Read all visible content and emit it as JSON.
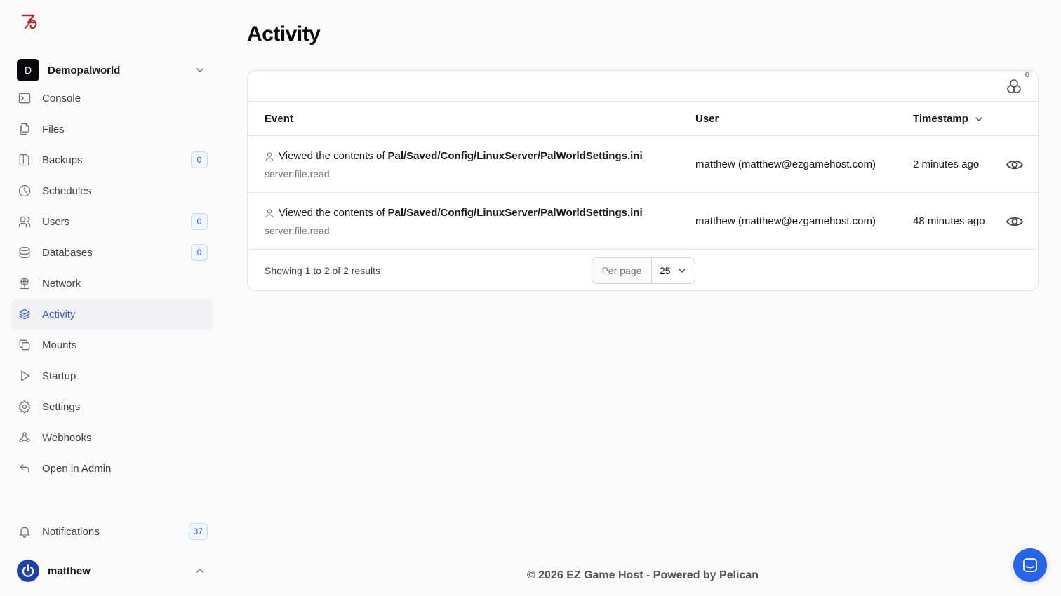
{
  "server": {
    "initial": "D",
    "name": "Demopalworld"
  },
  "sidebar": {
    "items": [
      {
        "label": "Console",
        "icon": "terminal-icon"
      },
      {
        "label": "Files",
        "icon": "files-icon"
      },
      {
        "label": "Backups",
        "icon": "file-zip-icon",
        "badge": "0"
      },
      {
        "label": "Schedules",
        "icon": "clock-icon"
      },
      {
        "label": "Users",
        "icon": "users-icon",
        "badge": "0"
      },
      {
        "label": "Databases",
        "icon": "database-icon",
        "badge": "0"
      },
      {
        "label": "Network",
        "icon": "network-icon"
      },
      {
        "label": "Activity",
        "icon": "stack-icon",
        "active": true
      },
      {
        "label": "Mounts",
        "icon": "mounts-icon"
      },
      {
        "label": "Startup",
        "icon": "play-icon"
      },
      {
        "label": "Settings",
        "icon": "gear-icon"
      },
      {
        "label": "Webhooks",
        "icon": "webhook-icon"
      },
      {
        "label": "Open in Admin",
        "icon": "arrow-back-icon"
      }
    ],
    "notifications": {
      "label": "Notifications",
      "badge": "37"
    },
    "user": {
      "name": "matthew"
    }
  },
  "page": {
    "title": "Activity"
  },
  "table": {
    "filter_count": "0",
    "headers": {
      "event": "Event",
      "user": "User",
      "timestamp": "Timestamp"
    },
    "rows": [
      {
        "event_prefix": "Viewed the contents of",
        "event_path": "Pal/Saved/Config/LinuxServer/PalWorldSettings.ini",
        "event_key": "server:file.read",
        "user": "matthew (matthew@ezgamehost.com)",
        "timestamp": "2 minutes ago"
      },
      {
        "event_prefix": "Viewed the contents of",
        "event_path": "Pal/Saved/Config/LinuxServer/PalWorldSettings.ini",
        "event_key": "server:file.read",
        "user": "matthew (matthew@ezgamehost.com)",
        "timestamp": "48 minutes ago"
      }
    ],
    "results_text": "Showing 1 to 2 of 2 results",
    "per_page_label": "Per page",
    "per_page_value": "25"
  },
  "footer": {
    "text": "© 2026 EZ Game Host - Powered by Pelican"
  },
  "colors": {
    "accent": "#3b5bdb",
    "badge_bg": "#eff6ff",
    "chat": "#2563eb"
  }
}
